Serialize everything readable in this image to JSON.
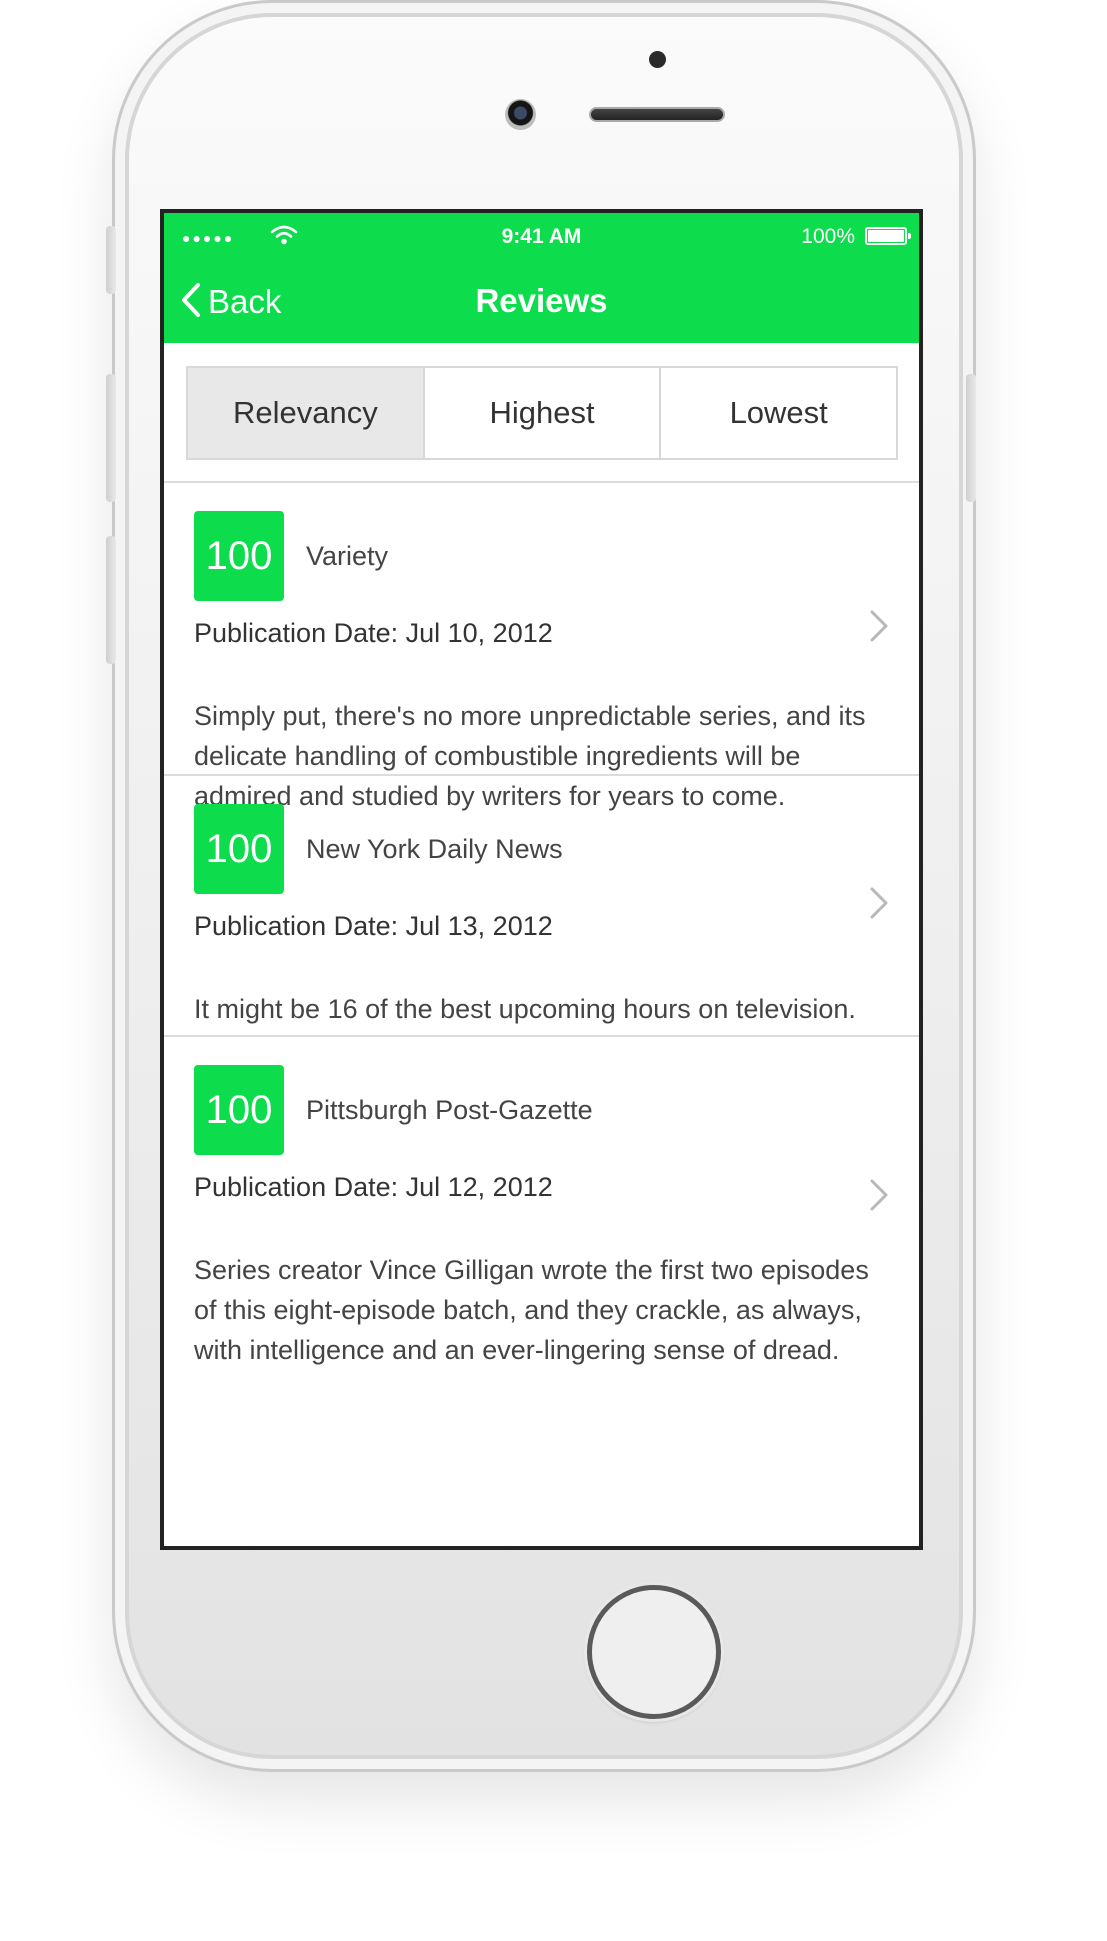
{
  "status_bar": {
    "signal": "●●●●●",
    "time": "9:41 AM",
    "battery": "100%"
  },
  "nav": {
    "back_label": "Back",
    "title": "Reviews"
  },
  "segments": [
    {
      "label": "Relevancy",
      "active": true
    },
    {
      "label": "Highest",
      "active": false
    },
    {
      "label": "Lowest",
      "active": false
    }
  ],
  "reviews": [
    {
      "score": "100",
      "source": "Variety",
      "date": "Publication Date: Jul 10, 2012",
      "quote": "Simply put, there's no more unpredictable series, and its delicate handling of combustible ingredients will be admired and studied by writers for years to come."
    },
    {
      "score": "100",
      "source": "New York Daily News",
      "date": "Publication Date: Jul 13, 2012",
      "quote": "It might be 16 of the best upcoming hours on television."
    },
    {
      "score": "100",
      "source": "Pittsburgh Post-Gazette",
      "date": "Publication Date: Jul 12, 2012",
      "quote": "Series creator Vince Gilligan wrote the first two episodes of this eight-episode batch, and they crackle, as always, with intelligence and an ever-lingering sense of dread."
    }
  ],
  "colors": {
    "accent": "#0ddc4d",
    "frame": "#222222"
  }
}
